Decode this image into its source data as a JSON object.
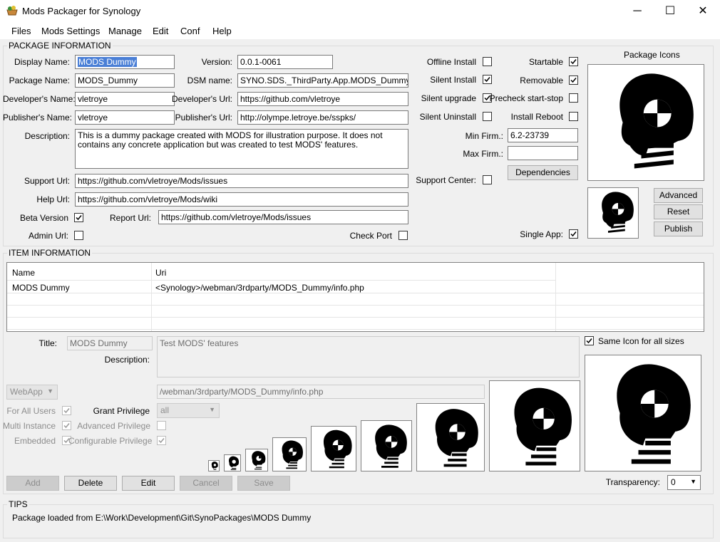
{
  "window": {
    "title": "Mods Packager for Synology",
    "app_icon": "package-icon"
  },
  "menu": [
    "Files",
    "Mods Settings",
    "Manage",
    "Edit",
    "Conf",
    "Help"
  ],
  "package": {
    "group_label": "PACKAGE INFORMATION",
    "display_name_label": "Display Name:",
    "display_name": "MODS Dummy",
    "version_label": "Version:",
    "version": "0.0.1-0061",
    "package_name_label": "Package Name:",
    "package_name": "MODS_Dummy",
    "dsm_name_label": "DSM name:",
    "dsm_name": "SYNO.SDS._ThirdParty.App.MODS_Dummy",
    "developer_name_label": "Developer's Name:",
    "developer_name": "vletroye",
    "developer_url_label": "Developer's Url:",
    "developer_url": "https://github.com/vletroye",
    "publisher_name_label": "Publisher's Name:",
    "publisher_name": "vletroye",
    "publisher_url_label": "Publisher's Url:",
    "publisher_url": "http://olympe.letroye.be/sspks/",
    "description_label": "Description:",
    "description": "This is a dummy package created with MODS for illustration purpose. It does not contains any concrete application but was created to test MODS' features.",
    "support_url_label": "Support Url:",
    "support_url": "https://github.com/vletroye/Mods/issues",
    "help_url_label": "Help Url:",
    "help_url": "https://github.com/vletroye/Mods/wiki",
    "beta_version_label": "Beta Version",
    "beta_version": true,
    "report_url_label": "Report Url:",
    "report_url": "https://github.com/vletroye/Mods/issues",
    "admin_url_label": "Admin Url:",
    "admin_url": false,
    "check_port_label": "Check Port",
    "check_port": false,
    "offline_install_label": "Offline Install",
    "offline_install": false,
    "startable_label": "Startable",
    "startable": true,
    "silent_install_label": "Silent Install",
    "silent_install": true,
    "removable_label": "Removable",
    "removable": true,
    "silent_upgrade_label": "Silent upgrade",
    "silent_upgrade": true,
    "precheck_label": "Precheck start-stop",
    "precheck": false,
    "silent_uninstall_label": "Silent Uninstall",
    "silent_uninstall": false,
    "install_reboot_label": "Install Reboot",
    "install_reboot": false,
    "min_firm_label": "Min Firm.:",
    "min_firm": "6.2-23739",
    "max_firm_label": "Max Firm.:",
    "max_firm": "",
    "dependencies_button": "Dependencies",
    "support_center_label": "Support Center:",
    "support_center": false,
    "single_app_label": "Single App:",
    "single_app": true,
    "package_icons_label": "Package Icons",
    "advanced_button": "Advanced",
    "reset_button": "Reset",
    "publish_button": "Publish"
  },
  "items": {
    "group_label": "ITEM INFORMATION",
    "columns": [
      "Name",
      "Uri"
    ],
    "rows": [
      {
        "name": "MODS Dummy",
        "uri": "<Synology>/webman/3rdparty/MODS_Dummy/info.php"
      }
    ],
    "title_label": "Title:",
    "title": "MODS Dummy",
    "title_desc": "Test MODS' features",
    "description_label": "Description:",
    "type": "WebApp",
    "url": "/webman/3rdparty/MODS_Dummy/info.php",
    "for_all_users_label": "For All Users",
    "for_all_users": true,
    "grant_privilege_label": "Grant Privilege",
    "grant_privilege": "all",
    "multi_instance_label": "Multi Instance",
    "multi_instance": true,
    "advanced_privilege_label": "Advanced Privilege",
    "advanced_privilege": false,
    "embedded_label": "Embedded",
    "embedded": true,
    "configurable_privilege_label": "Configurable Privilege",
    "configurable_privilege": true,
    "same_icon_label": "Same Icon for all sizes",
    "same_icon": true,
    "transparency_label": "Transparency:",
    "transparency": "0",
    "buttons": {
      "add": "Add",
      "delete": "Delete",
      "edit": "Edit",
      "cancel": "Cancel",
      "save": "Save"
    }
  },
  "tips": {
    "group_label": "TIPS",
    "text": "Package loaded from E:\\Work\\Development\\Git\\SynoPackages\\MODS Dummy"
  }
}
